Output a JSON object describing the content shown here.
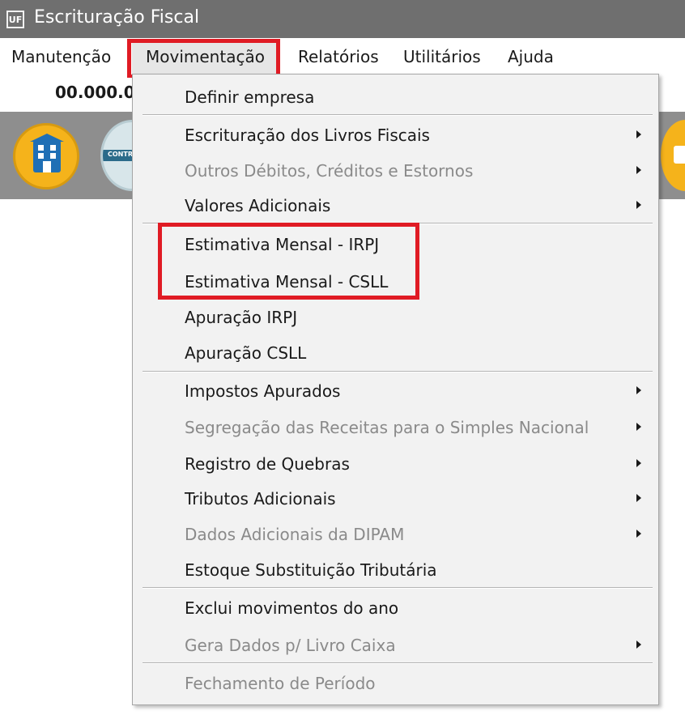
{
  "window": {
    "title": "Escrituração Fiscal",
    "app_icon_text": "UF"
  },
  "menubar": {
    "items": [
      {
        "label": "Manutenção"
      },
      {
        "label": "Movimentação"
      },
      {
        "label": "Relatórios"
      },
      {
        "label": "Utilitários"
      },
      {
        "label": "Ajuda"
      }
    ],
    "active": "Movimentação"
  },
  "company": {
    "code": "00.000.0"
  },
  "toolbar": {
    "buttons": [
      {
        "icon": "building-icon"
      },
      {
        "icon": "contract-icon",
        "text": "CONTR"
      },
      {
        "icon": "chat-icon"
      }
    ]
  },
  "dropdown": {
    "items": [
      {
        "label": "Definir empresa",
        "enabled": true,
        "submenu": false
      },
      {
        "label": "Escrituração dos Livros Fiscais",
        "enabled": true,
        "submenu": true
      },
      {
        "label": "Outros Débitos, Créditos e Estornos",
        "enabled": false,
        "submenu": true
      },
      {
        "label": "Valores Adicionais",
        "enabled": true,
        "submenu": true
      },
      {
        "label": "Estimativa Mensal - IRPJ",
        "enabled": true,
        "submenu": false
      },
      {
        "label": "Estimativa Mensal - CSLL",
        "enabled": true,
        "submenu": false
      },
      {
        "label": "Apuração IRPJ",
        "enabled": true,
        "submenu": false
      },
      {
        "label": "Apuração CSLL",
        "enabled": true,
        "submenu": false
      },
      {
        "label": "Impostos Apurados",
        "enabled": true,
        "submenu": true
      },
      {
        "label": "Segregação das Receitas para o Simples Nacional",
        "enabled": false,
        "submenu": true
      },
      {
        "label": "Registro de Quebras",
        "enabled": true,
        "submenu": true
      },
      {
        "label": "Tributos Adicionais",
        "enabled": true,
        "submenu": true
      },
      {
        "label": "Dados Adicionais da DIPAM",
        "enabled": false,
        "submenu": true
      },
      {
        "label": "Estoque Substituição Tributária",
        "enabled": true,
        "submenu": false
      },
      {
        "label": "Exclui movimentos do ano",
        "enabled": true,
        "submenu": false
      },
      {
        "label": "Gera Dados p/ Livro Caixa",
        "enabled": false,
        "submenu": true
      },
      {
        "label": "Fechamento de Período",
        "enabled": false,
        "submenu": false
      }
    ]
  },
  "colors": {
    "titlebar": "#6f6f6f",
    "toolbar": "#8e8e8e",
    "menu_background": "#f2f2f2",
    "highlight_box": "#e01b24",
    "disabled_text": "#8a8a8a"
  }
}
